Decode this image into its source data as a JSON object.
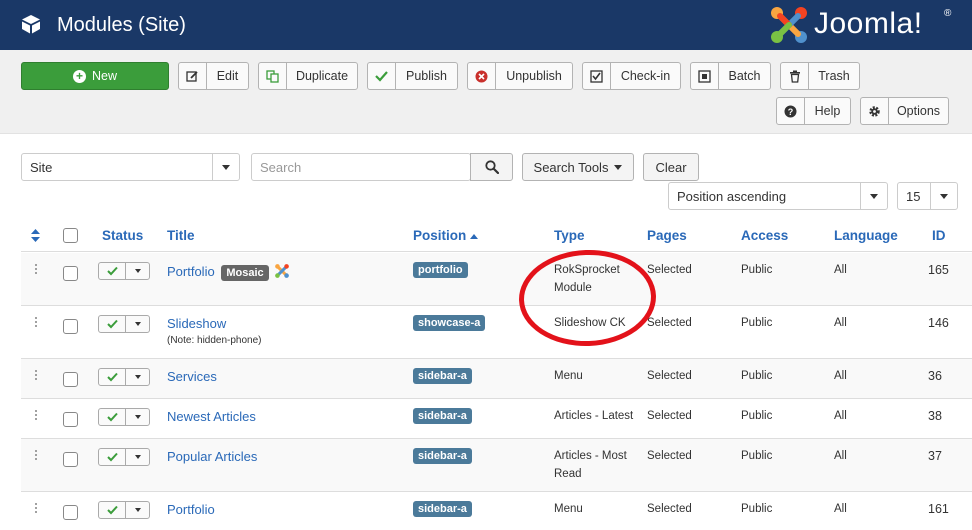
{
  "header": {
    "title": "Modules (Site)",
    "brand": "Joomla!",
    "brand_mark": "®"
  },
  "toolbar": {
    "new": "New",
    "edit": "Edit",
    "duplicate": "Duplicate",
    "publish": "Publish",
    "unpublish": "Unpublish",
    "checkin": "Check-in",
    "batch": "Batch",
    "trash": "Trash",
    "help": "Help",
    "options": "Options"
  },
  "filters": {
    "client": "Site",
    "search_placeholder": "Search",
    "search_tools": "Search Tools",
    "clear": "Clear",
    "ordering": "Position ascending",
    "limit": "15"
  },
  "table": {
    "columns": {
      "status": "Status",
      "title": "Title",
      "position": "Position",
      "type": "Type",
      "pages": "Pages",
      "access": "Access",
      "language": "Language",
      "id": "ID"
    },
    "rows": [
      {
        "title": "Portfolio",
        "badge": "Mosaic",
        "position": "portfolio",
        "type_line1": "RokSprocket",
        "type_line2": "Module",
        "pages": "Selected",
        "access": "Public",
        "language": "All",
        "id": "165"
      },
      {
        "title": "Slideshow",
        "note": "(Note: hidden-phone)",
        "position": "showcase-a",
        "type_line1": "Slideshow CK",
        "pages": "Selected",
        "access": "Public",
        "language": "All",
        "id": "146"
      },
      {
        "title": "Services",
        "position": "sidebar-a",
        "type_line1": "Menu",
        "pages": "Selected",
        "access": "Public",
        "language": "All",
        "id": "36"
      },
      {
        "title": "Newest Articles",
        "position": "sidebar-a",
        "type_line1": "Articles - Latest",
        "pages": "Selected",
        "access": "Public",
        "language": "All",
        "id": "38"
      },
      {
        "title": "Popular Articles",
        "position": "sidebar-a",
        "type_line1": "Articles - Most",
        "type_line2": "Read",
        "pages": "Selected",
        "access": "Public",
        "language": "All",
        "id": "37"
      },
      {
        "title": "Portfolio",
        "position": "sidebar-a",
        "type_line1": "Menu",
        "pages": "Selected",
        "access": "Public",
        "language": "All",
        "id": "161"
      }
    ]
  },
  "colors": {
    "header_bg": "#1a3867",
    "accent_link": "#2a69b8",
    "new_button": "#3b9d3b",
    "annotation_circle": "#e3121a",
    "position_tag": "#4b7a9a"
  },
  "icons": [
    "cube-icon",
    "joomla-logo-icon",
    "plus-circle-icon",
    "edit-icon",
    "copy-icon",
    "check-icon",
    "times-circle-icon",
    "checkbox-icon",
    "batch-icon",
    "trash-icon",
    "question-icon",
    "gear-icon",
    "search-icon",
    "sort-icon",
    "drag-handle-icon"
  ]
}
